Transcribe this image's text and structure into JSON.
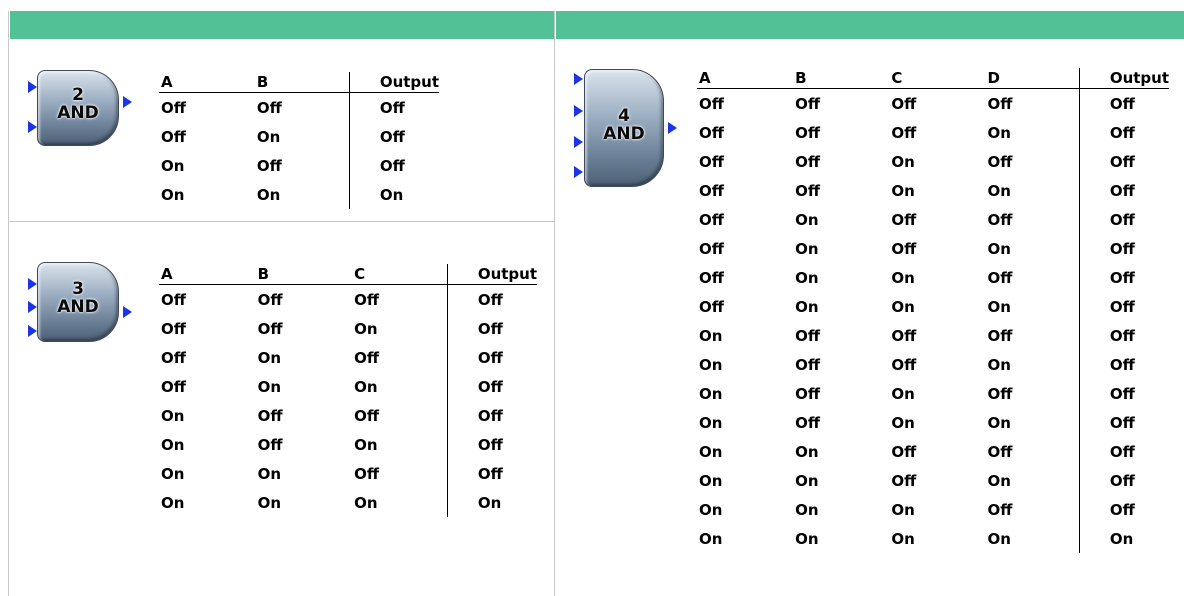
{
  "tables": [
    {
      "gate": {
        "inputs_label": "2",
        "name": "AND"
      },
      "headers": [
        "A",
        "B",
        "Output"
      ],
      "rows": [
        [
          "Off",
          "Off",
          "Off"
        ],
        [
          "Off",
          "On",
          "Off"
        ],
        [
          "On",
          "Off",
          "Off"
        ],
        [
          "On",
          "On",
          "On"
        ]
      ]
    },
    {
      "gate": {
        "inputs_label": "3",
        "name": "AND"
      },
      "headers": [
        "A",
        "B",
        "C",
        "Output"
      ],
      "rows": [
        [
          "Off",
          "Off",
          "Off",
          "Off"
        ],
        [
          "Off",
          "Off",
          "On",
          "Off"
        ],
        [
          "Off",
          "On",
          "Off",
          "Off"
        ],
        [
          "Off",
          "On",
          "On",
          "Off"
        ],
        [
          "On",
          "Off",
          "Off",
          "Off"
        ],
        [
          "On",
          "Off",
          "On",
          "Off"
        ],
        [
          "On",
          "On",
          "Off",
          "Off"
        ],
        [
          "On",
          "On",
          "On",
          "On"
        ]
      ]
    },
    {
      "gate": {
        "inputs_label": "4",
        "name": "AND"
      },
      "headers": [
        "A",
        "B",
        "C",
        "D",
        "Output"
      ],
      "rows": [
        [
          "Off",
          "Off",
          "Off",
          "Off",
          "Off"
        ],
        [
          "Off",
          "Off",
          "Off",
          "On",
          "Off"
        ],
        [
          "Off",
          "Off",
          "On",
          "Off",
          "Off"
        ],
        [
          "Off",
          "Off",
          "On",
          "On",
          "Off"
        ],
        [
          "Off",
          "On",
          "Off",
          "Off",
          "Off"
        ],
        [
          "Off",
          "On",
          "Off",
          "On",
          "Off"
        ],
        [
          "Off",
          "On",
          "On",
          "Off",
          "Off"
        ],
        [
          "Off",
          "On",
          "On",
          "On",
          "Off"
        ],
        [
          "On",
          "Off",
          "Off",
          "Off",
          "Off"
        ],
        [
          "On",
          "Off",
          "Off",
          "On",
          "Off"
        ],
        [
          "On",
          "Off",
          "On",
          "Off",
          "Off"
        ],
        [
          "On",
          "Off",
          "On",
          "On",
          "Off"
        ],
        [
          "On",
          "On",
          "Off",
          "Off",
          "Off"
        ],
        [
          "On",
          "On",
          "Off",
          "On",
          "Off"
        ],
        [
          "On",
          "On",
          "On",
          "Off",
          "Off"
        ],
        [
          "On",
          "On",
          "On",
          "On",
          "On"
        ]
      ]
    }
  ],
  "colors": {
    "header_bar": "#53c196",
    "arrow": "#1c33e6",
    "gate_body": "#7f93a9"
  }
}
